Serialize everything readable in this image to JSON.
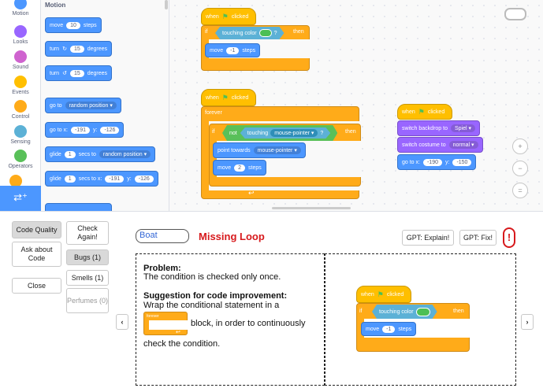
{
  "categories": [
    {
      "label": "Motion",
      "color": "#4c97ff"
    },
    {
      "label": "Looks",
      "color": "#9966ff"
    },
    {
      "label": "Sound",
      "color": "#cf63cf"
    },
    {
      "label": "Events",
      "color": "#ffbf00"
    },
    {
      "label": "Control",
      "color": "#ffab19"
    },
    {
      "label": "Sensing",
      "color": "#5cb1d6"
    },
    {
      "label": "Operators",
      "color": "#59c059"
    }
  ],
  "palette": {
    "title": "Motion",
    "move": "move",
    "move_n": "10",
    "steps": "steps",
    "turn": "turn",
    "turn_cw": "15",
    "degrees": "degrees",
    "turn_ccw": "15",
    "goto": "go to",
    "random": "random position",
    "goto_xy": "go to x:",
    "x": "-191",
    "y_lbl": "y:",
    "y": "-126",
    "glide": "glide",
    "glide_n": "1",
    "secs_to": "secs to",
    "secs_to_x": "secs to x:"
  },
  "ws": {
    "when_clicked": "when",
    "clicked": "clicked",
    "if": "if",
    "touching_color": "touching color",
    "q": "?",
    "then": "then",
    "move": "move",
    "move_val": "-1",
    "steps": "steps",
    "forever": "forever",
    "not": "not",
    "touching": "touching",
    "mouse_pointer": "mouse-pointer",
    "point_towards": "point towards",
    "move2": "2",
    "switch_backdrop": "switch backdrop to",
    "backdrop": "Spiel",
    "switch_costume": "switch costume to",
    "costume": "normal",
    "goto_x": "go to x:",
    "gx": "-190",
    "gy_lbl": "y:",
    "gy": "-150"
  },
  "panel": {
    "code_quality": "Code Quality",
    "check_again": "Check Again!",
    "ask_about": "Ask about Code",
    "bugs": "Bugs (1)",
    "smells": "Smells (1)",
    "perfumes": "Perfumes (0)",
    "close": "Close",
    "sprite": "Boat",
    "issue": "Missing Loop",
    "gpt_explain": "GPT: Explain!",
    "gpt_fix": "GPT: Fix!",
    "problem_h": "Problem:",
    "problem_t": "The condition is checked only once.",
    "sugg_h": "Suggestion for code improvement:",
    "sugg_t1": "Wrap the conditional statement in a",
    "forever": "forever",
    "sugg_t2": "block, in order to continuously",
    "sugg_t3": "check the condition."
  }
}
